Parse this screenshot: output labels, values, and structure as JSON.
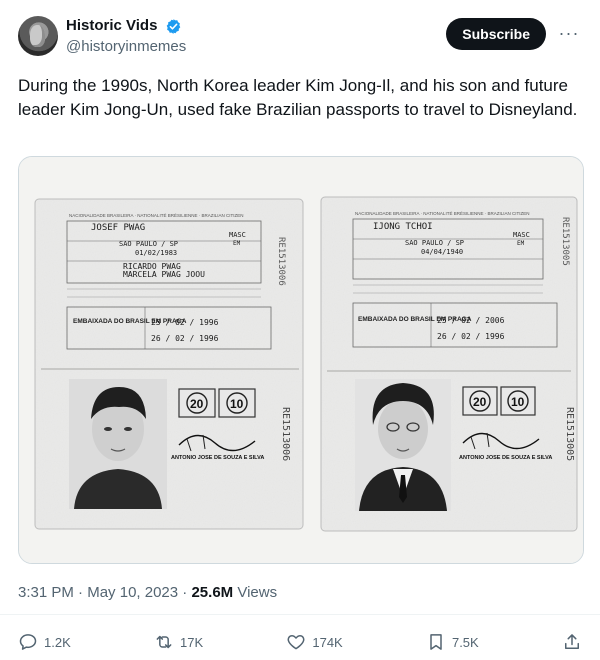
{
  "author": {
    "display_name": "Historic Vids",
    "handle": "@historyinmemes",
    "subscribe_label": "Subscribe"
  },
  "tweet": {
    "text": "During the 1990s, North Korea leader Kim Jong-Il, and his son and future leader Kim Jong-Un, used fake Brazilian passports to travel to Disneyland."
  },
  "media": {
    "left_passport": {
      "header": "NACIONALIDADE BRASILEIRA · NATIONALITÉ BRÉSILIENNE · BRAZILIAN CITIZEN",
      "name": "JOSEF PWAG",
      "sex": "MASC",
      "place": "SAO PAULO / SP",
      "country": "EM",
      "dob": "01/02/1983",
      "father": "RICARDO PWAG",
      "mother": "MARCELA PWAG JOOU",
      "embassy": "EMBAIXADA DO BRASIL EM PRAGA",
      "issued": "25 / 02 / 1996",
      "expires": "26 / 02 / 1996",
      "stamp_a": "20",
      "stamp_b": "10",
      "consul": "ANTONIO JOSE DE SOUZA E SILVA",
      "serial": "RE1513006"
    },
    "right_passport": {
      "header": "NACIONALIDADE BRASILEIRA · NATIONALITÉ BRÉSILIENNE · BRAZILIAN CITIZEN",
      "name": "IJONG TCHOI",
      "sex": "MASC",
      "place": "SAO PAULO / SP",
      "country": "EM",
      "dob": "04/04/1940",
      "embassy": "EMBAIXADA DO BRASIL EM PRAGA",
      "issued": "25 / 02 / 2006",
      "expires": "26 / 02 / 1996",
      "stamp_a": "20",
      "stamp_b": "10",
      "consul": "ANTONIO JOSE DE SOUZA E SILVA",
      "serial": "RE1513005"
    }
  },
  "meta": {
    "time": "3:31 PM",
    "separator": "·",
    "date": "May 10, 2023",
    "views_count": "25.6M",
    "views_label": "Views"
  },
  "actions": {
    "replies": "1.2K",
    "reposts": "17K",
    "likes": "174K",
    "bookmarks": "7.5K"
  },
  "colors": {
    "subscribe_bg": "#0f1419",
    "verified": "#1d9bf0",
    "secondary_text": "#536471"
  }
}
